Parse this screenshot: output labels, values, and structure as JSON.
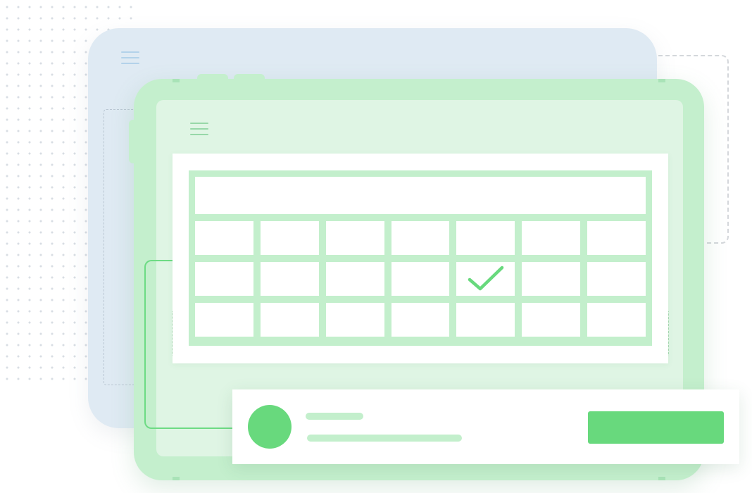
{
  "illustration": {
    "accent_color": "#68d97d",
    "tablet_front_color": "#c4efcd",
    "tablet_back_color": "#dfeaf3",
    "icons": {
      "back_menu": "hamburger-menu-icon",
      "front_menu": "hamburger-menu-icon",
      "calendar_mark": "checkmark-icon",
      "user": "avatar-circle"
    }
  },
  "calendar": {
    "columns": 7,
    "rows": 3,
    "checked_cell": {
      "row": 2,
      "column": 5
    }
  }
}
